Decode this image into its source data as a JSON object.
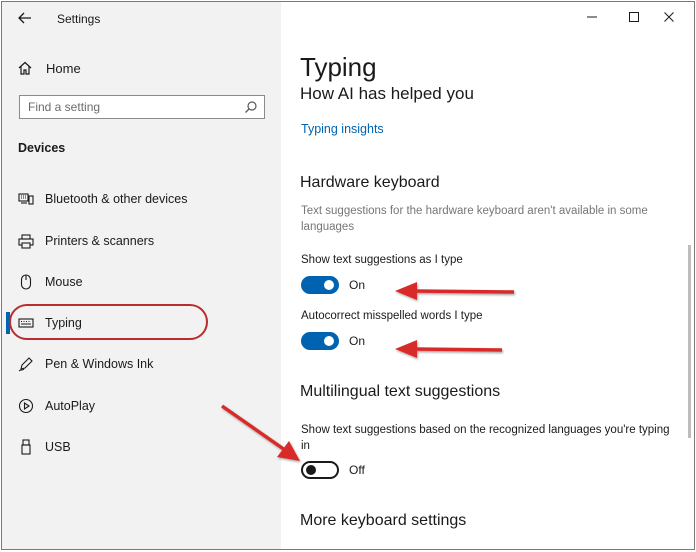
{
  "window": {
    "title": "Settings"
  },
  "sidebar": {
    "home_label": "Home",
    "search_placeholder": "Find a setting",
    "section_label": "Devices",
    "items": [
      {
        "label": "Bluetooth & other devices",
        "icon": "bluetooth-devices-icon"
      },
      {
        "label": "Printers & scanners",
        "icon": "printer-icon"
      },
      {
        "label": "Mouse",
        "icon": "mouse-icon"
      },
      {
        "label": "Typing",
        "icon": "keyboard-icon",
        "selected": true
      },
      {
        "label": "Pen & Windows Ink",
        "icon": "pen-icon"
      },
      {
        "label": "AutoPlay",
        "icon": "autoplay-icon"
      },
      {
        "label": "USB",
        "icon": "usb-icon"
      }
    ]
  },
  "content": {
    "title": "Typing",
    "subheading": "How AI has helped you",
    "link": "Typing insights",
    "hardware": {
      "heading": "Hardware keyboard",
      "description": "Text suggestions for the hardware keyboard aren't available in some languages",
      "text_suggestions": {
        "label": "Show text suggestions as I type",
        "state": "On"
      },
      "autocorrect": {
        "label": "Autocorrect misspelled words I type",
        "state": "On"
      }
    },
    "multilingual": {
      "heading": "Multilingual text suggestions",
      "label": "Show text suggestions based on the recognized languages you're typing in",
      "state": "Off"
    },
    "more_heading": "More keyboard settings"
  },
  "colors": {
    "accent": "#0063b1",
    "annotation_red": "#d92b2b",
    "sidebar_bg": "#f2f2f2"
  }
}
